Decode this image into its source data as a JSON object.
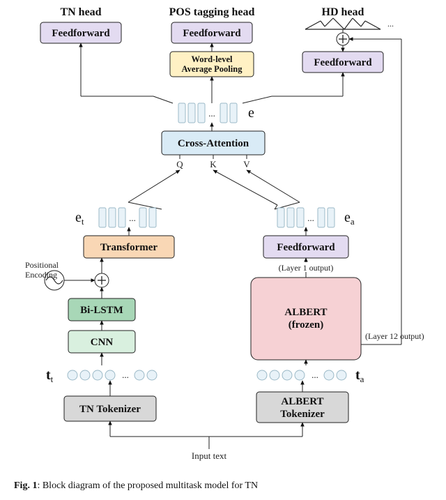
{
  "heads": {
    "tn": "TN head",
    "pos": "POS tagging head",
    "hd": "HD head"
  },
  "blocks": {
    "feedforward": "Feedforward",
    "avgpool_l1": "Word-level",
    "avgpool_l2": "Average Pooling",
    "cross_attention": "Cross-Attention",
    "transformer": "Transformer",
    "bilstm": "Bi-LSTM",
    "cnn": "CNN",
    "tn_tokenizer": "TN Tokenizer",
    "albert_tokenizer_l1": "ALBERT",
    "albert_tokenizer_l2": "Tokenizer",
    "albert_l1": "ALBERT",
    "albert_l2": "(frozen)"
  },
  "labels": {
    "positional_l1": "Positional",
    "positional_l2": "Encoding",
    "layer1": "(Layer 1 output)",
    "layer12": "(Layer 12 output)",
    "Q": "Q",
    "K": "K",
    "V": "V",
    "input_text": "Input text",
    "dots": "...",
    "e": "e",
    "et": "e",
    "et_sub": "t",
    "ea": "e",
    "ea_sub": "a",
    "tt": "t",
    "tt_sub": "t",
    "ta": "t",
    "ta_sub": "a"
  },
  "caption": {
    "prefix": "Fig. 1",
    "text": ": Block diagram of the proposed multitask model for TN"
  },
  "colors": {
    "purple": "#e3dbf1",
    "yellow": "#fff1c4",
    "blue": "#d9ebf6",
    "orange": "#f9d7b5",
    "green_dark": "#a8d7b7",
    "green_light": "#d9f0df",
    "grey": "#d8d8d8",
    "pink": "#f6d1d4",
    "token_fill": "#e8f2f8",
    "token_stroke": "#9bb9c7",
    "border": "#222"
  }
}
